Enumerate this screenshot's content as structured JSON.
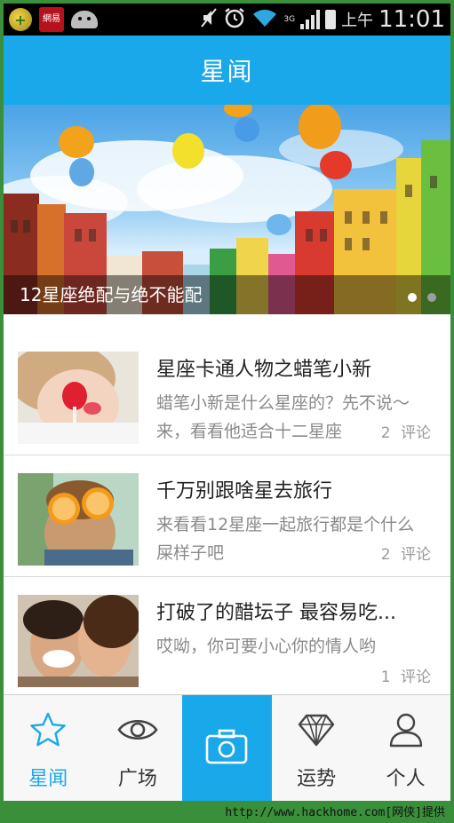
{
  "status_bar": {
    "signal_label": "3G",
    "am_pm": "上午",
    "time": "11:01",
    "icons": [
      "app-icon",
      "netease-icon",
      "android-icon",
      "mute-icon",
      "alarm-icon",
      "wifi-icon",
      "signal-icon",
      "battery-icon"
    ]
  },
  "header": {
    "title": "星闻"
  },
  "banner": {
    "caption": "12星座绝配与绝不能配",
    "dots": 2,
    "active_dot": 0
  },
  "articles": [
    {
      "title": "星座卡通人物之蜡笔小新",
      "desc": "蜡笔小新是什么星座的？先不说～来，看看他适合十二星座",
      "comments": "2",
      "comments_label": "评论"
    },
    {
      "title": "千万别跟啥星去旅行",
      "desc": "来看看12星座一起旅行都是个什么屎样子吧",
      "comments": "2",
      "comments_label": "评论"
    },
    {
      "title": "打破了的醋坛子 最容易吃...",
      "desc": "哎呦，你可要小心你的情人哟",
      "comments": "1",
      "comments_label": "评论"
    }
  ],
  "tabs": [
    {
      "label": "星闻",
      "icon": "star-icon",
      "active": true
    },
    {
      "label": "广场",
      "icon": "eye-icon",
      "active": false
    },
    {
      "label": "",
      "icon": "camera-icon",
      "active": false
    },
    {
      "label": "运势",
      "icon": "diamond-icon",
      "active": false
    },
    {
      "label": "个人",
      "icon": "person-icon",
      "active": false
    }
  ],
  "colors": {
    "accent": "#19a9ea",
    "text": "#222222",
    "muted": "#8a8a8a"
  },
  "footer": {
    "watermark": "http://www.hackhome.com[网侠]提供"
  }
}
